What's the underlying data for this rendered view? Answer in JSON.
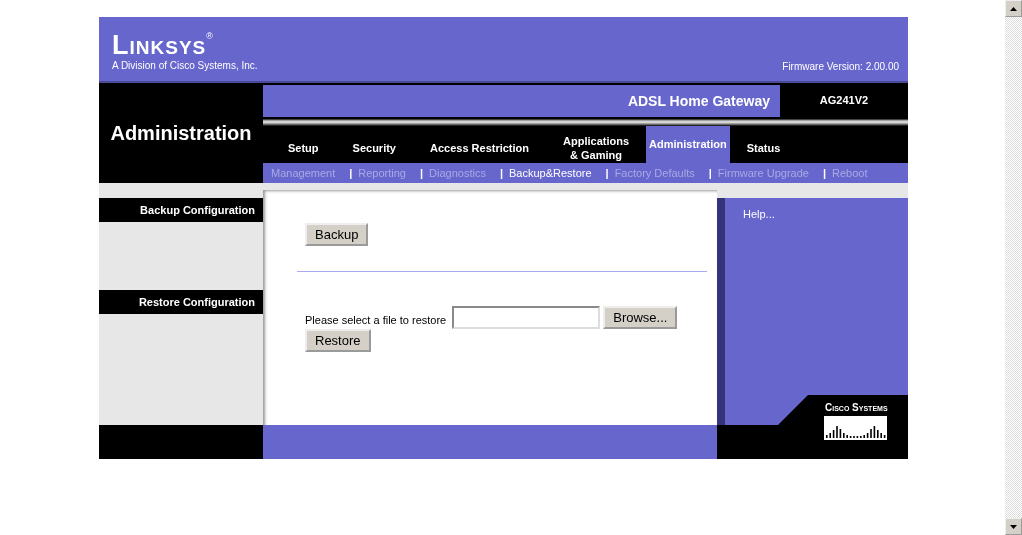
{
  "header": {
    "brand": "Linksys",
    "registered": "®",
    "tagline": "A Division of Cisco Systems, Inc.",
    "firmware": "Firmware Version: 2.00.00"
  },
  "section_title": "Administration",
  "product": {
    "name": "ADSL Home Gateway",
    "model": "AG241V2"
  },
  "tabs": [
    {
      "label": "Setup",
      "selected": false
    },
    {
      "label": "Security",
      "selected": false
    },
    {
      "label": "Access Restriction",
      "selected": false
    },
    {
      "label": "Applications\n& Gaming",
      "selected": false
    },
    {
      "label": "Administration",
      "selected": true
    },
    {
      "label": "Status",
      "selected": false
    }
  ],
  "subtabs": [
    {
      "label": "Management",
      "selected": false
    },
    {
      "label": "Reporting",
      "selected": false,
      "divider": "|"
    },
    {
      "label": "Diagnostics",
      "selected": false,
      "divider": "|"
    },
    {
      "label": "Backup&Restore",
      "selected": true,
      "divider": "|"
    },
    {
      "label": "Factory Defaults",
      "selected": false,
      "divider": "|"
    },
    {
      "label": "Firmware Upgrade",
      "selected": false,
      "divider": "|"
    },
    {
      "label": "Reboot",
      "selected": false,
      "divider": "|"
    }
  ],
  "sections": [
    "Backup Configuration",
    "Restore Configuration"
  ],
  "backup_button": "Backup",
  "restore": {
    "label": "Please select a file to restore",
    "browse_button": "Browse...",
    "restore_button": "Restore"
  },
  "help_link": "Help...",
  "footer_logo": "Cisco Systems"
}
